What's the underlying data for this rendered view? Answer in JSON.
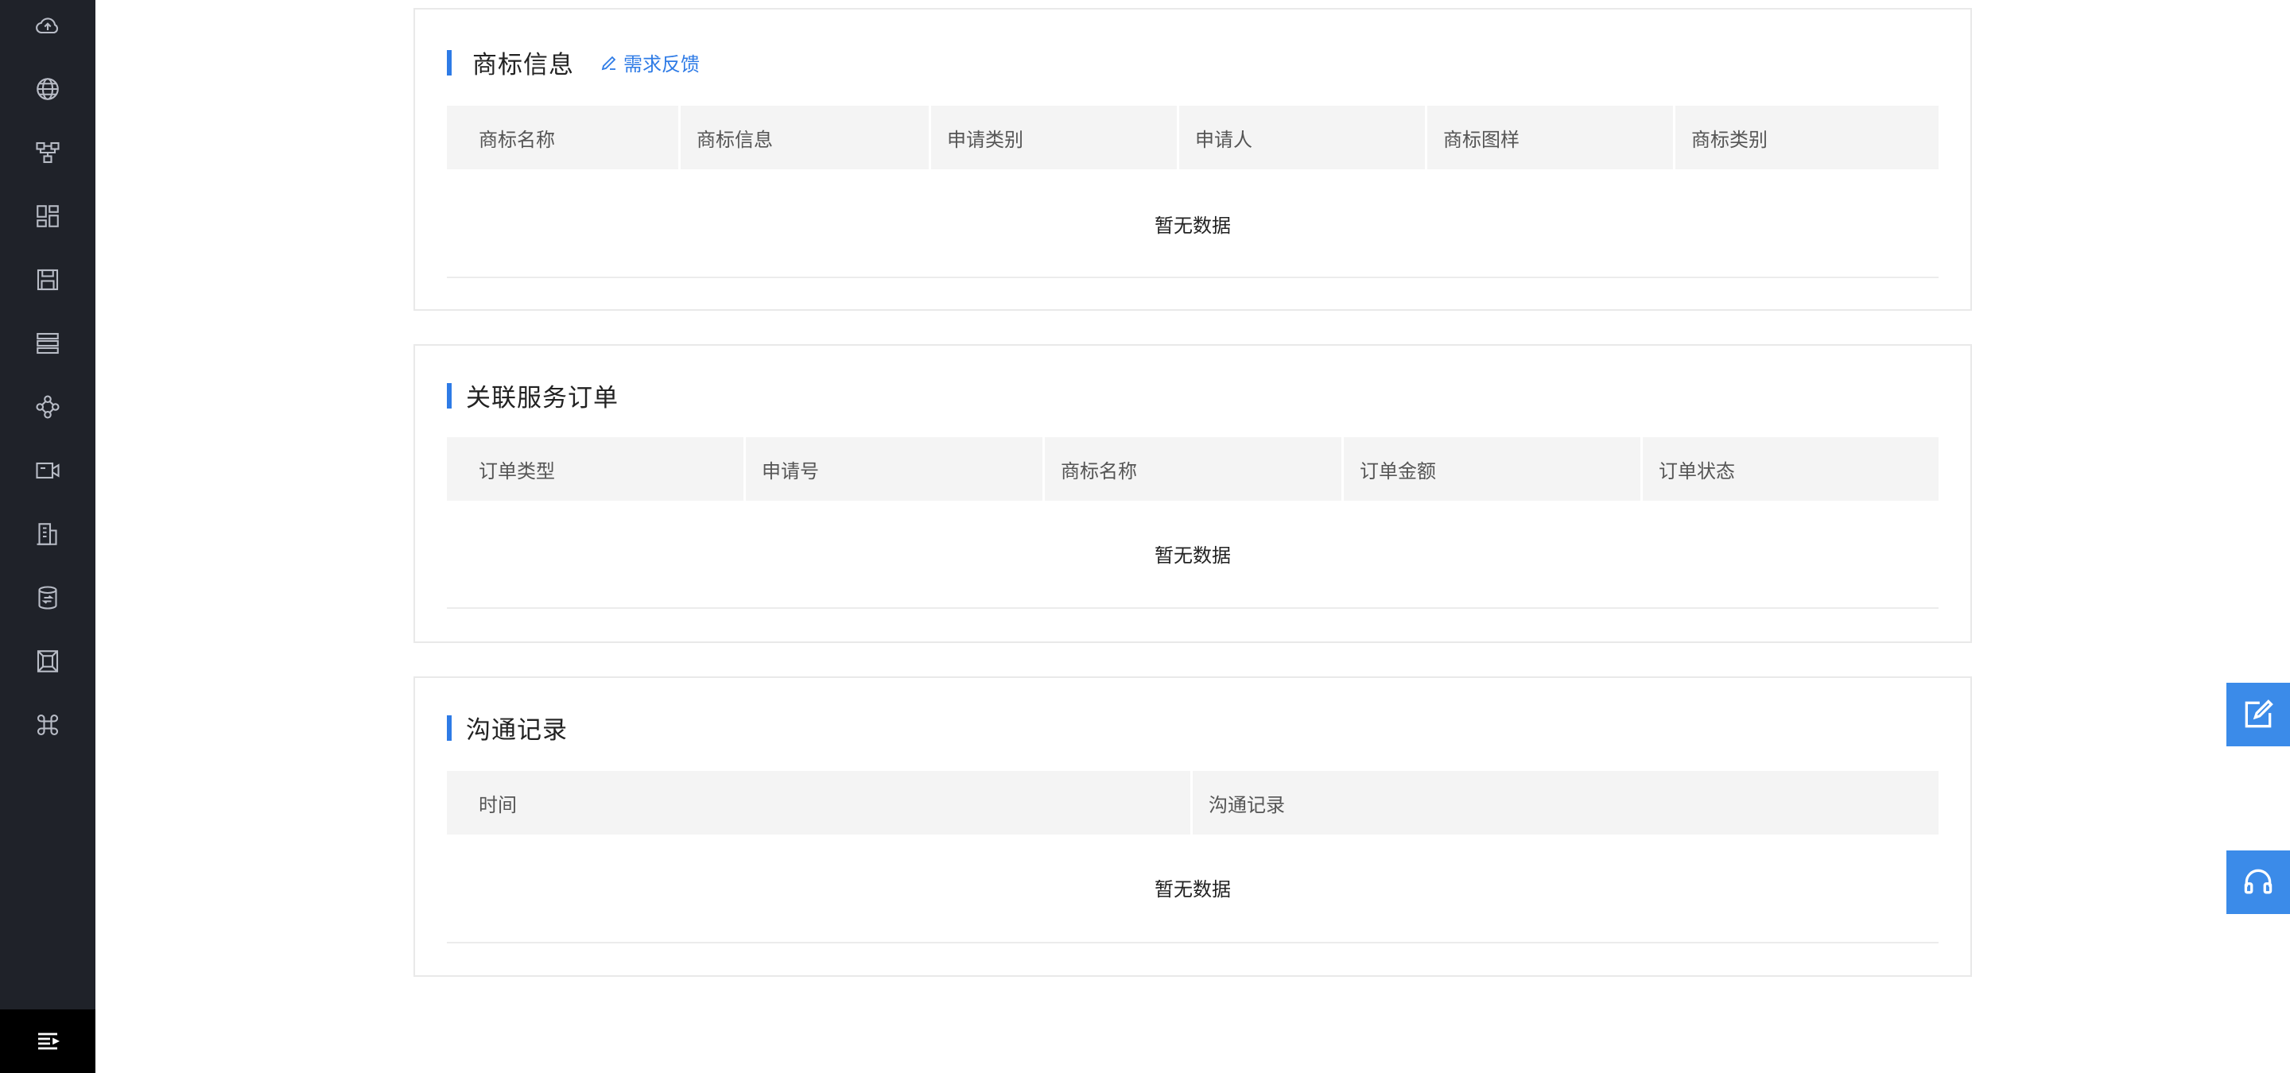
{
  "sidebar": {
    "icons": [
      "cloud-upload-icon",
      "globe-icon",
      "network-icon",
      "dashboard-icon",
      "save-icon",
      "list-icon",
      "share-nodes-icon",
      "video-icon",
      "building-icon",
      "database-icon",
      "frame-icon",
      "command-icon"
    ],
    "toggle_icon": "menu-collapse-icon"
  },
  "trademark": {
    "title": "商标信息",
    "feedback_label": "需求反馈",
    "columns": [
      "商标名称",
      "商标信息",
      "申请类别",
      "申请人",
      "商标图样",
      "商标类别"
    ],
    "empty": "暂无数据"
  },
  "orders": {
    "title": "关联服务订单",
    "columns": [
      "订单类型",
      "申请号",
      "商标名称",
      "订单金额",
      "订单状态"
    ],
    "empty": "暂无数据"
  },
  "communication": {
    "title": "沟通记录",
    "columns": [
      "时间",
      "沟通记录"
    ],
    "empty": "暂无数据"
  },
  "colors": {
    "accent": "#2e7be6",
    "sidebar": "#1f2229",
    "float": "#3b8be9"
  },
  "float_buttons": [
    "edit-icon",
    "headset-icon"
  ]
}
